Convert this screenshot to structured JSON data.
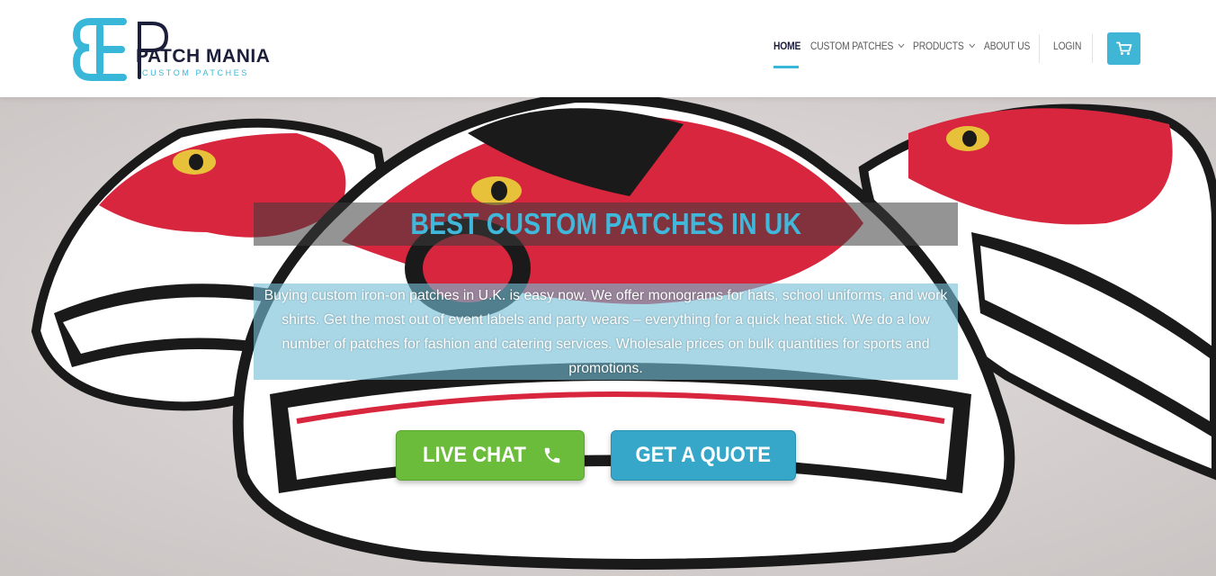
{
  "brand": {
    "name": "PATCH MANIA",
    "tagline": "CUSTOM PATCHES",
    "logo_icon": "pm-monogram-icon"
  },
  "nav": {
    "items": [
      {
        "label": "HOME",
        "active": true
      },
      {
        "label": "CUSTOM PATCHES",
        "dropdown": true
      },
      {
        "label": "PRODUCTS",
        "dropdown": true
      },
      {
        "label": "ABOUT US"
      },
      {
        "label": "LOGIN"
      }
    ],
    "cart_icon": "shopping-cart-icon"
  },
  "hero": {
    "title": "BEST CUSTOM PATCHES IN UK",
    "description": "Buying custom iron-on patches in U.K. is easy now. We offer monograms for hats, school uniforms, and work shirts. Get the most out of event labels and party wears – everything for a quick heat stick. We do a low number of patches for fashion and catering services. Wholesale prices on bulk quantities for sports and promotions.",
    "background_image": "embroidered-eagle-scream-patches",
    "buttons": {
      "live_chat": {
        "label": "LIVE CHAT",
        "icon": "phone-icon"
      },
      "get_quote": {
        "label": "GET A QUOTE"
      }
    }
  },
  "colors": {
    "accent": "#39b7d9",
    "brand_dark": "#1c1f3a",
    "chat_green": "#6cbc3c",
    "quote_blue": "#36a7c8",
    "nav_text": "#5b5b5b"
  }
}
